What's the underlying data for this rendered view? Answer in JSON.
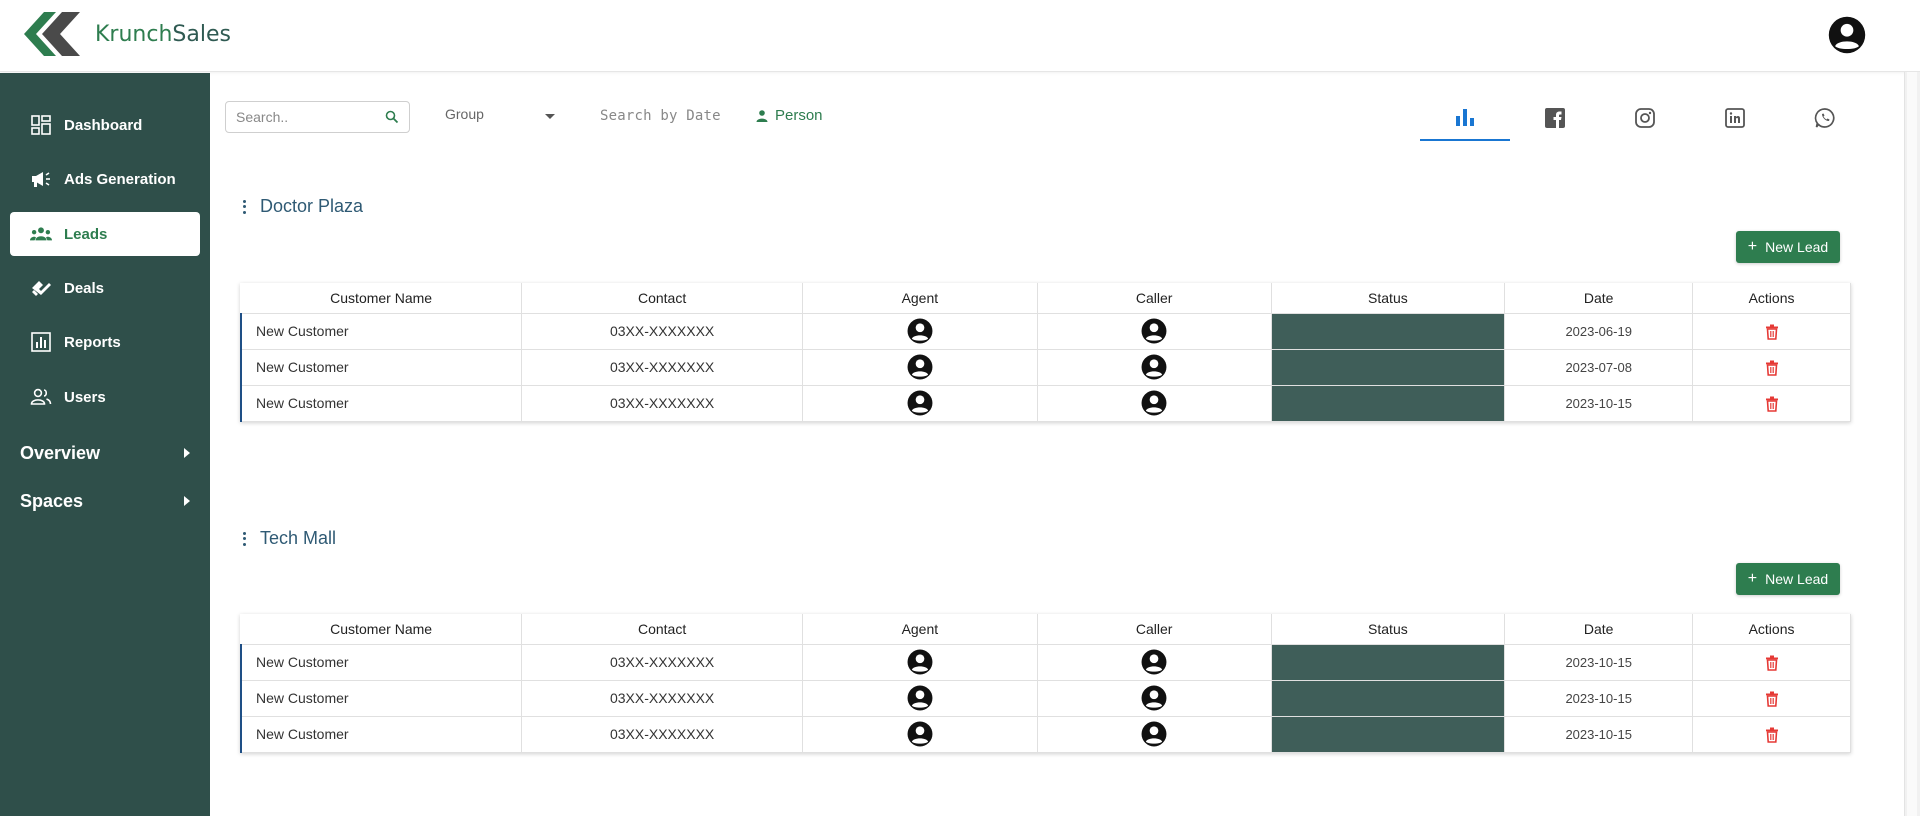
{
  "header": {
    "brand_part1": "Krunch",
    "brand_part2": "Sales",
    "logo_icon": "krunchsales-logo",
    "avatar_icon": "user-avatar-icon"
  },
  "sidebar": {
    "items": [
      {
        "label": "Dashboard",
        "icon": "dashboard-icon",
        "active": false
      },
      {
        "label": "Ads Generation",
        "icon": "megaphone-icon",
        "active": false
      },
      {
        "label": "Leads",
        "icon": "leads-group-icon",
        "active": true
      },
      {
        "label": "Deals",
        "icon": "handshake-icon",
        "active": false
      },
      {
        "label": "Reports",
        "icon": "bar-chart-icon",
        "active": false
      },
      {
        "label": "Users",
        "icon": "users-icon",
        "active": false
      }
    ],
    "groups": [
      {
        "label": "Overview"
      },
      {
        "label": "Spaces"
      }
    ]
  },
  "filters": {
    "search_placeholder": "Search..",
    "group_label": "Group",
    "date_placeholder": "Search by Date",
    "person_label": "Person"
  },
  "tabs": [
    {
      "icon": "bar-chart-icon",
      "active": true
    },
    {
      "icon": "facebook-icon",
      "active": false
    },
    {
      "icon": "instagram-icon",
      "active": false
    },
    {
      "icon": "linkedin-icon",
      "active": false
    },
    {
      "icon": "whatsapp-icon",
      "active": false
    }
  ],
  "table_headers": [
    "Customer Name",
    "Contact",
    "Agent",
    "Caller",
    "Status",
    "Date",
    "Actions"
  ],
  "new_lead_label": "New Lead",
  "groups": [
    {
      "title": "Doctor Plaza",
      "rows": [
        {
          "name": "New Customer",
          "contact": "03XX-XXXXXXX",
          "date": "2023-06-19"
        },
        {
          "name": "New Customer",
          "contact": "03XX-XXXXXXX",
          "date": "2023-07-08"
        },
        {
          "name": "New Customer",
          "contact": "03XX-XXXXXXX",
          "date": "2023-10-15"
        }
      ]
    },
    {
      "title": "Tech Mall",
      "rows": [
        {
          "name": "New Customer",
          "contact": "03XX-XXXXXXX",
          "date": "2023-10-15"
        },
        {
          "name": "New Customer",
          "contact": "03XX-XXXXXXX",
          "date": "2023-10-15"
        },
        {
          "name": "New Customer",
          "contact": "03XX-XXXXXXX",
          "date": "2023-10-15"
        }
      ]
    }
  ],
  "colors": {
    "sidebar_bg": "#2f4f4a",
    "accent_green": "#2e7d4f",
    "status_cell": "#3f5e59",
    "tab_active": "#1976d2",
    "delete_red": "#e53935"
  }
}
